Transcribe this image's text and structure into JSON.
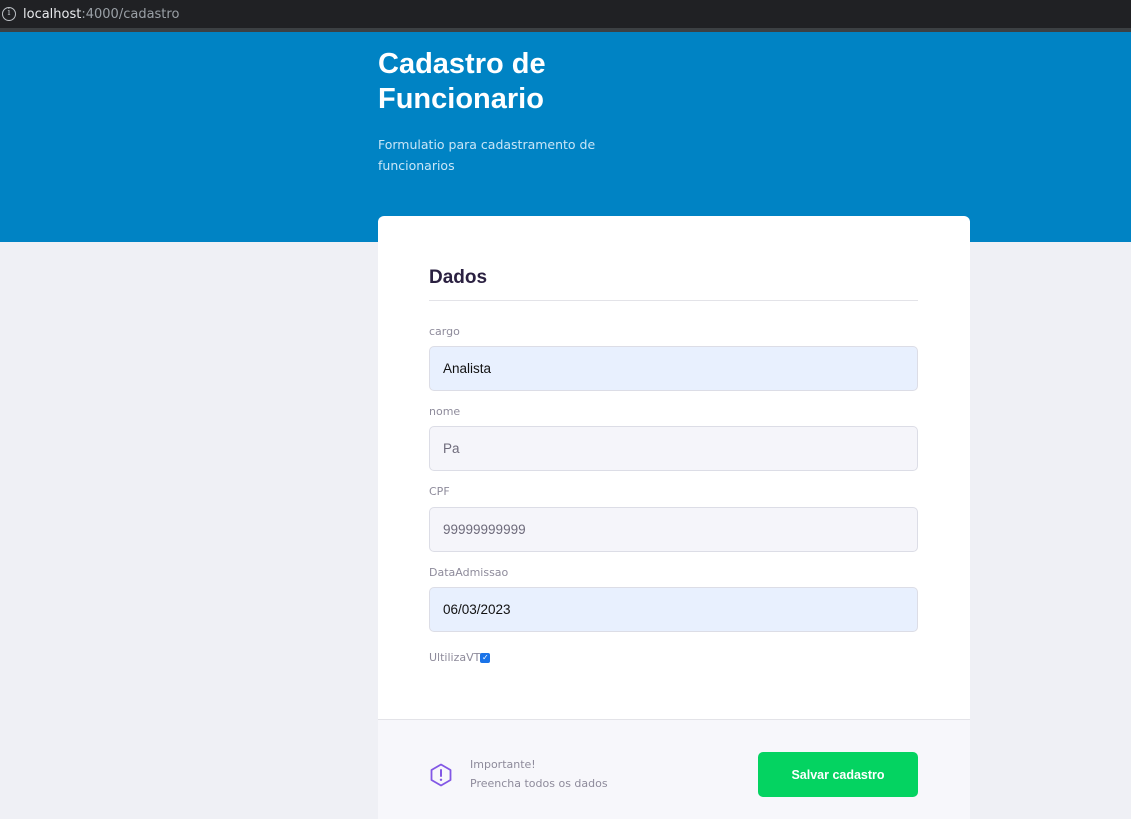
{
  "browser": {
    "url_host": "localhost",
    "url_path": ":4000/cadastro"
  },
  "header": {
    "title": "Cadastro de Funcionario",
    "subtitle": "Formulatio para cadastramento de funcionarios"
  },
  "form": {
    "section_title": "Dados",
    "fields": [
      {
        "label": "cargo",
        "value": "Analista"
      },
      {
        "label": "nome",
        "value": "Pa"
      },
      {
        "label": "CPF",
        "value": "99999999999"
      },
      {
        "label": "DataAdmissao",
        "value": "06/03/2023"
      }
    ],
    "checkbox": {
      "label": "UltilizaVT",
      "checked": true
    }
  },
  "footer": {
    "note_title": "Importante!",
    "note_body": "Preencha todos os dados",
    "save_label": "Salvar cadastro"
  },
  "colors": {
    "hero": "#0083c4",
    "save_button": "#04d361",
    "warning_icon": "#8257e5"
  }
}
